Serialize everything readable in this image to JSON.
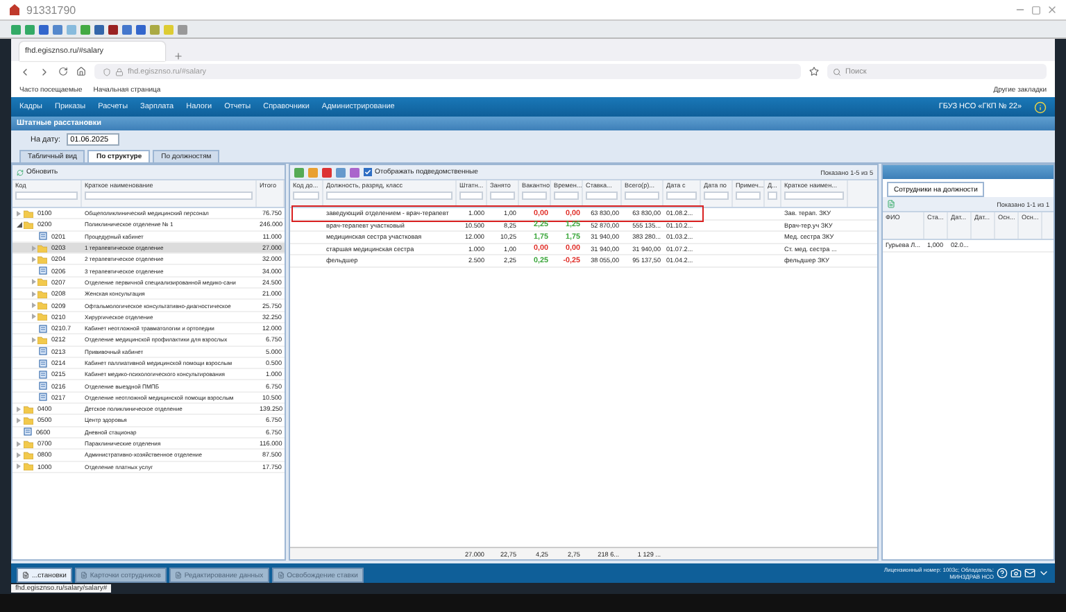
{
  "window": {
    "title": "91331790"
  },
  "browser": {
    "tab": "fhd.egisznso.ru/#salary",
    "address": "fhd.egisznso.ru/#salary",
    "search": {
      "placeholder": "Поиск"
    },
    "bookmarks": [
      "Часто посещаемые",
      "Начальная страница"
    ],
    "other_bookmarks": "Другие закладки",
    "status_url": "fhd.egisznso.ru/salary/salary#"
  },
  "menu": [
    "Кадры",
    "Приказы",
    "Расчеты",
    "Зарплата",
    "Налоги",
    "Отчеты",
    "Справочники",
    "Администрирование"
  ],
  "organization": "ГБУЗ НСО «ГКП № 22»",
  "panel": {
    "title": "Штатные расстановки",
    "date_label": "На дату:",
    "date": "01.06.2025",
    "tabs": [
      {
        "label": "Табличный вид",
        "selected": false
      },
      {
        "label": "По структуре",
        "selected": true
      },
      {
        "label": "По должностям",
        "selected": false
      }
    ]
  },
  "tree": {
    "refresh": "Обновить",
    "columns": [
      "Код",
      "Краткое наименование",
      "Итого"
    ],
    "items": [
      {
        "code": "0100",
        "name": "Общеполиклинический медицинский персонал",
        "total": "76.750",
        "kind": "folder",
        "expanded": false,
        "selected": false
      },
      {
        "code": "0200",
        "name": "Поликлиническое отделение № 1",
        "total": "246.000",
        "kind": "folder",
        "expanded": true,
        "selected": false,
        "children": [
          {
            "code": "0201",
            "name": "Процедурный кабинет",
            "total": "11.000",
            "kind": "leaf",
            "selected": false
          },
          {
            "code": "0203",
            "name": "1 терапевтическое отделение",
            "total": "27.000",
            "kind": "folder",
            "expanded": false,
            "selected": true
          },
          {
            "code": "0204",
            "name": "2 терапевтическое отделение",
            "total": "32.000",
            "kind": "folder",
            "expanded": false,
            "selected": false
          },
          {
            "code": "0206",
            "name": "3 терапевтическое отделение",
            "total": "34.000",
            "kind": "leaf",
            "selected": false
          },
          {
            "code": "0207",
            "name": "Отделение первичной специализированной медико-сани",
            "total": "24.500",
            "kind": "folder",
            "expanded": false,
            "selected": false
          },
          {
            "code": "0208",
            "name": "Женская консультация",
            "total": "21.000",
            "kind": "folder",
            "expanded": false,
            "selected": false
          },
          {
            "code": "0209",
            "name": "Офтальмологическое консультативно-диагностическое",
            "total": "25.750",
            "kind": "folder",
            "expanded": false,
            "selected": false
          },
          {
            "code": "0210",
            "name": "Хирургическое отделение",
            "total": "32.250",
            "kind": "folder",
            "expanded": false,
            "selected": false
          },
          {
            "code": "0210.7",
            "name": "Кабинет неотложной травматологии и ортопедии",
            "total": "12.000",
            "kind": "leaf",
            "selected": false
          },
          {
            "code": "0212",
            "name": "Отделение медицинской профилактики для взрослых",
            "total": "6.750",
            "kind": "folder",
            "expanded": false,
            "selected": false
          },
          {
            "code": "0213",
            "name": "Прививочный кабинет",
            "total": "5.000",
            "kind": "leaf",
            "selected": false
          },
          {
            "code": "0214",
            "name": "Кабинет паллиативной медицинской помощи взрослым",
            "total": "0.500",
            "kind": "leaf",
            "selected": false
          },
          {
            "code": "0215",
            "name": "Кабинет медико-психологического консультирования",
            "total": "1.000",
            "kind": "leaf",
            "selected": false
          },
          {
            "code": "0216",
            "name": "Отделение выездной ПМПБ",
            "total": "6.750",
            "kind": "leaf",
            "selected": false
          },
          {
            "code": "0217",
            "name": "Отделение неотложной медицинской помощи взрослым",
            "total": "10.500",
            "kind": "leaf",
            "selected": false
          }
        ]
      },
      {
        "code": "0400",
        "name": "Детское поликлиническое отделение",
        "total": "139.250",
        "kind": "folder",
        "expanded": false,
        "selected": false
      },
      {
        "code": "0500",
        "name": "Центр здоровья",
        "total": "6.750",
        "kind": "folder",
        "expanded": false,
        "selected": false
      },
      {
        "code": "0600",
        "name": "Дневной стационар",
        "total": "6.750",
        "kind": "leaf",
        "selected": false
      },
      {
        "code": "0700",
        "name": "Параклинические отделения",
        "total": "116.000",
        "kind": "folder",
        "expanded": false,
        "selected": false
      },
      {
        "code": "0800",
        "name": "Административно-хозяйственное отделение",
        "total": "87.500",
        "kind": "folder",
        "expanded": false,
        "selected": false
      },
      {
        "code": "1000",
        "name": "Отделение платных услуг",
        "total": "17.750",
        "kind": "folder",
        "expanded": false,
        "selected": false
      }
    ]
  },
  "positions": {
    "show_subordinate": {
      "label": "Отображать подведомственные",
      "checked": true
    },
    "paging": "Показано 1-5 из 5",
    "columns": [
      "Код до...",
      "Должность, разряд, класс",
      "Штатн...",
      "Занято",
      "Вакантно",
      "Времен...",
      "Ставка...",
      "Всего(р)...",
      "Дата с",
      "Дата по",
      "Примеч...",
      "Д...",
      "Краткое наимен..."
    ],
    "rows": [
      {
        "cells": [
          "",
          "заведующий отделением - врач-терапевт",
          "1.000",
          "1,00",
          {
            "text": "0,00",
            "color": "#e0302a"
          },
          {
            "text": "0,00",
            "color": "#e0302a"
          },
          "63 830,00",
          "63 830,00",
          "01.08.2...",
          "",
          "",
          "",
          "Зав. терап. ЗКУ"
        ],
        "framed": true
      },
      {
        "cells": [
          "",
          "врач-терапевт участковый",
          "10.500",
          "8,25",
          {
            "text": "2,25",
            "color": "#3aa63a"
          },
          {
            "text": "1,25",
            "color": "#3aa63a"
          },
          "52 870,00",
          "555 135...",
          "01.10.2...",
          "",
          "",
          "",
          "Врач-тер.уч ЗКУ"
        ],
        "framed": false
      },
      {
        "cells": [
          "",
          "медицинская сестра участковая",
          "12.000",
          "10,25",
          {
            "text": "1,75",
            "color": "#3aa63a"
          },
          {
            "text": "1,75",
            "color": "#3aa63a"
          },
          "31 940,00",
          "383 280...",
          "01.03.2...",
          "",
          "",
          "",
          "Мед. сестра ЗКУ"
        ],
        "framed": false
      },
      {
        "cells": [
          "",
          "старшая медицинская сестра",
          "1.000",
          "1,00",
          {
            "text": "0,00",
            "color": "#e0302a"
          },
          {
            "text": "0,00",
            "color": "#e0302a"
          },
          "31 940,00",
          "31 940,00",
          "01.07.2...",
          "",
          "",
          "",
          "Ст. мед. сестра ..."
        ],
        "framed": false
      },
      {
        "cells": [
          "",
          "фельдшер",
          "2.500",
          "2,25",
          {
            "text": "0,25",
            "color": "#3aa63a"
          },
          {
            "text": "-0,25",
            "color": "#e0302a"
          },
          "38 055,00",
          "95 137,50",
          "01.04.2...",
          "",
          "",
          "",
          "фельдшер ЗКУ"
        ],
        "framed": false
      }
    ],
    "totals": [
      "27.000",
      "22,75",
      "4,25",
      "2,75",
      "218 6...",
      "1 129 ..."
    ]
  },
  "employees": {
    "tab": "Сотрудники на должности",
    "paging": "Показано 1-1 из 1",
    "columns": [
      "ФИО",
      "Ста...",
      "Дат...",
      "Дат...",
      "Осн...",
      "Осн..."
    ],
    "rows": [
      [
        "Гурьева Л...",
        "1,000",
        "02.0...",
        "",
        "",
        ""
      ]
    ]
  },
  "taskbar": {
    "tabs": [
      {
        "label": "...становки",
        "selected": true
      },
      {
        "label": "Карточки сотрудников",
        "selected": false
      },
      {
        "label": "Редактирование данных",
        "selected": false
      },
      {
        "label": "Освобождение ставки",
        "selected": false
      }
    ],
    "license": "Лицензионный номер: 1003с; Обладатель:",
    "owner": "МИНЗДРАВ НСО"
  }
}
